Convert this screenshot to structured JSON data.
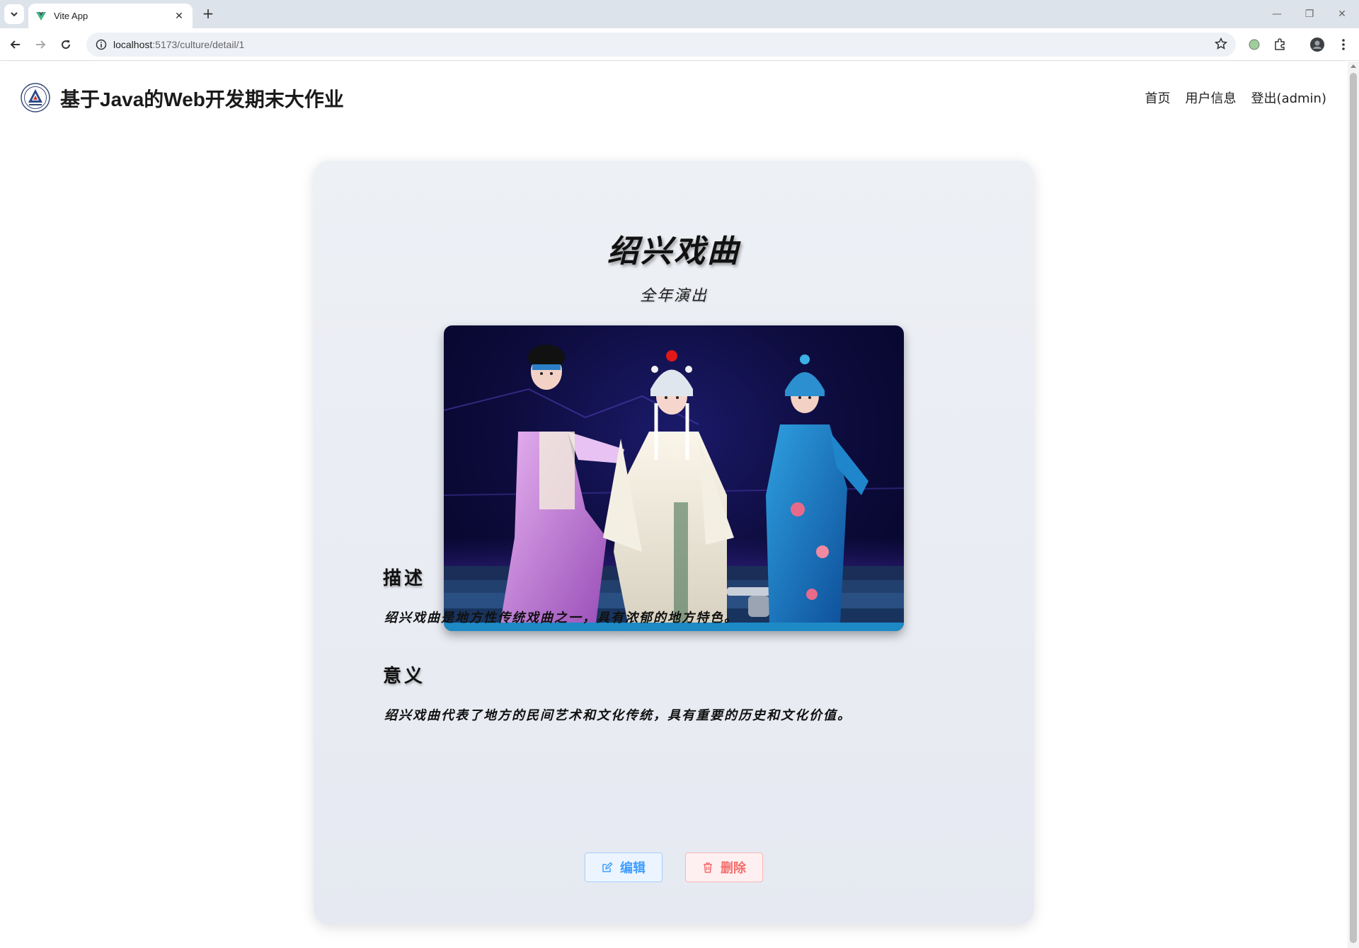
{
  "browser": {
    "tab_title": "Vite App",
    "url_host": "localhost",
    "url_rest": ":5173/culture/detail/1"
  },
  "header": {
    "site_title": "基于Java的Web开发期末大作业",
    "nav": [
      "首页",
      "用户信息",
      "登出(admin)"
    ]
  },
  "detail": {
    "title": "绍兴戏曲",
    "subtitle": "全年演出",
    "description_heading": "描述",
    "description": "绍兴戏曲是地方性传统戏曲之一，具有浓郁的地方特色。",
    "significance_heading": "意义",
    "significance": "绍兴戏曲代表了地方的民间艺术和文化传统，具有重要的历史和文化价值。"
  },
  "actions": {
    "edit_label": "编辑",
    "delete_label": "删除"
  },
  "colors": {
    "edit": "#409eff",
    "delete": "#f56c6c"
  }
}
